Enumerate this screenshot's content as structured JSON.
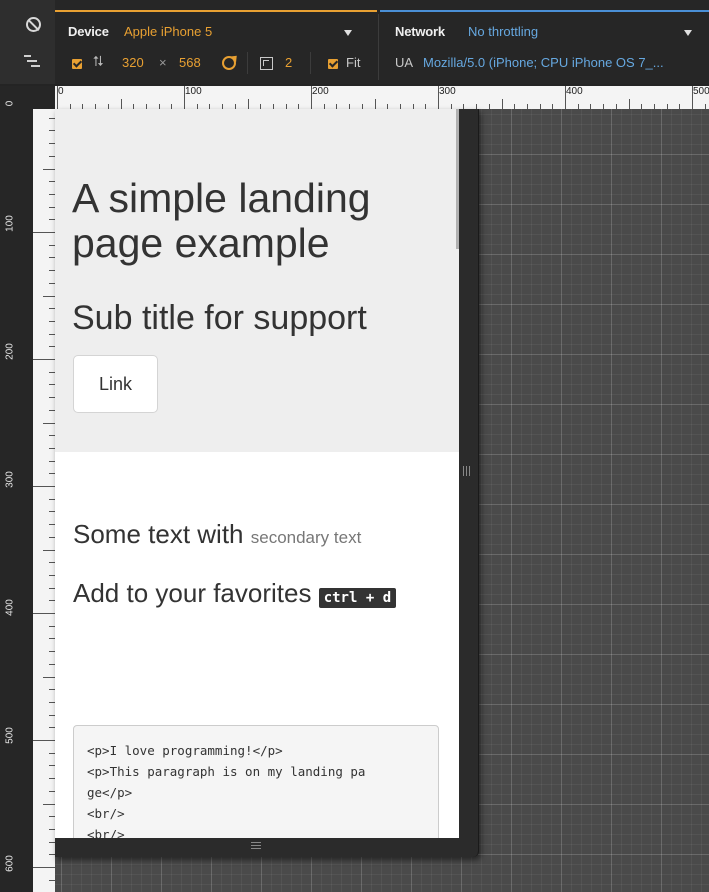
{
  "toolbar": {
    "device_label": "Device",
    "device_value": "Apple iPhone 5",
    "network_label": "Network",
    "network_value": "No throttling",
    "width": "320",
    "times": "×",
    "height": "568",
    "scale": "2",
    "fit_label": "Fit",
    "ua_label": "UA",
    "ua_value": "Mozilla/5.0 (iPhone; CPU iPhone OS 7_...",
    "accent_color": "#e8a032",
    "network_accent_color": "#4a8fd6"
  },
  "rulers": {
    "horizontal_labels": [
      "0",
      "100",
      "200",
      "300",
      "400",
      "500"
    ],
    "vertical_labels": [
      "0",
      "100",
      "200",
      "300",
      "400",
      "500",
      "600"
    ]
  },
  "page": {
    "title": "A simple landing page example",
    "subtitle": "Sub title for support",
    "link_label": "Link",
    "text_main": "Some text with ",
    "text_secondary": "secondary text",
    "favorites_text": "Add to your favorites ",
    "shortcut": "ctrl + d",
    "code_lines": [
      "<p>I love programming!</p>",
      "<p>This paragraph is on my landing pa",
      "ge</p>",
      "<br/>",
      "<br/>"
    ]
  }
}
